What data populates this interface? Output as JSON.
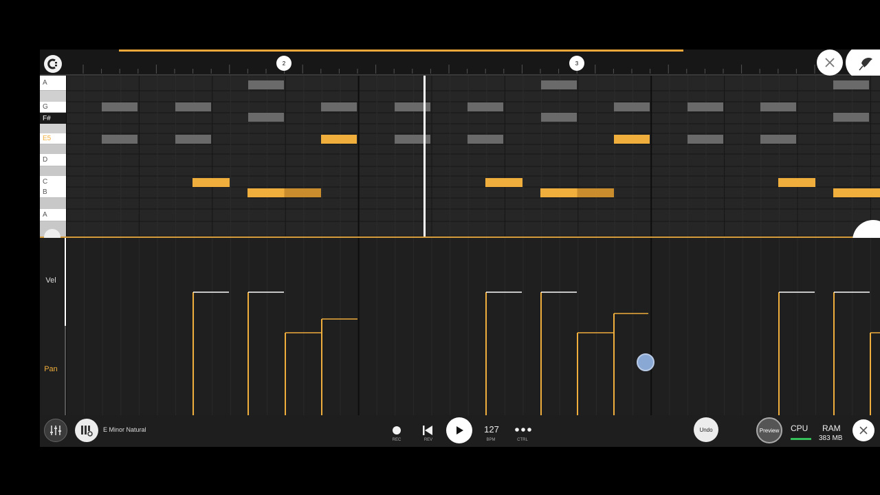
{
  "timeline": {
    "markers": [
      "2",
      "3"
    ]
  },
  "keys": {
    "labels": [
      "A",
      "G",
      "F#",
      "E5",
      "D",
      "C",
      "B",
      "A"
    ]
  },
  "lanes": {
    "vel": "Vel",
    "pan": "Pan"
  },
  "bottom": {
    "scale": "E Minor Natural",
    "rec": "REC",
    "rev": "REV",
    "bpm_value": "127",
    "bpm": "BPM",
    "ctrl": "CTRL",
    "undo": "Undo",
    "preview": "Preview",
    "cpu": "CPU",
    "ram": "RAM",
    "ram_value": "383 MB"
  },
  "colors": {
    "accent": "#f0ae3c",
    "note_inactive": "#6a6a6a"
  }
}
